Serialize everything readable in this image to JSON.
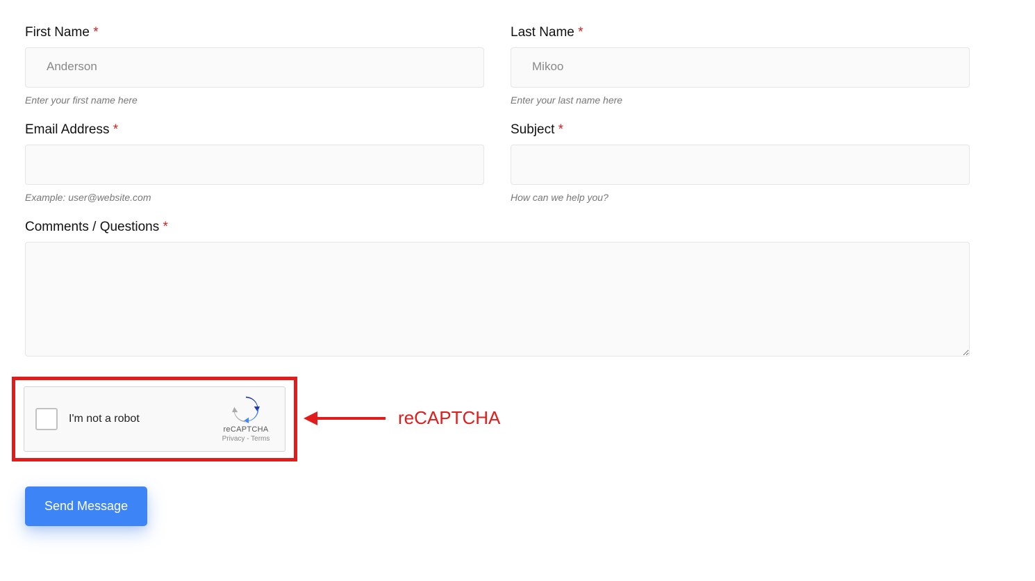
{
  "form": {
    "first_name": {
      "label": "First Name",
      "required": "*",
      "placeholder": "Anderson",
      "value": "",
      "help": "Enter your first name here"
    },
    "last_name": {
      "label": "Last Name",
      "required": "*",
      "placeholder": "Mikoo",
      "value": "",
      "help": "Enter your last name here"
    },
    "email": {
      "label": "Email Address",
      "required": "*",
      "placeholder": "",
      "value": "",
      "help": "Example: user@website.com"
    },
    "subject": {
      "label": "Subject",
      "required": "*",
      "placeholder": "",
      "value": "",
      "help": "How can we help you?"
    },
    "comments": {
      "label": "Comments / Questions",
      "required": "*",
      "value": ""
    }
  },
  "recaptcha": {
    "label": "I'm not a robot",
    "brand": "reCAPTCHA",
    "privacy": "Privacy",
    "separator": " - ",
    "terms": "Terms"
  },
  "annotation": {
    "text": "reCAPTCHA"
  },
  "submit": {
    "label": "Send Message"
  }
}
